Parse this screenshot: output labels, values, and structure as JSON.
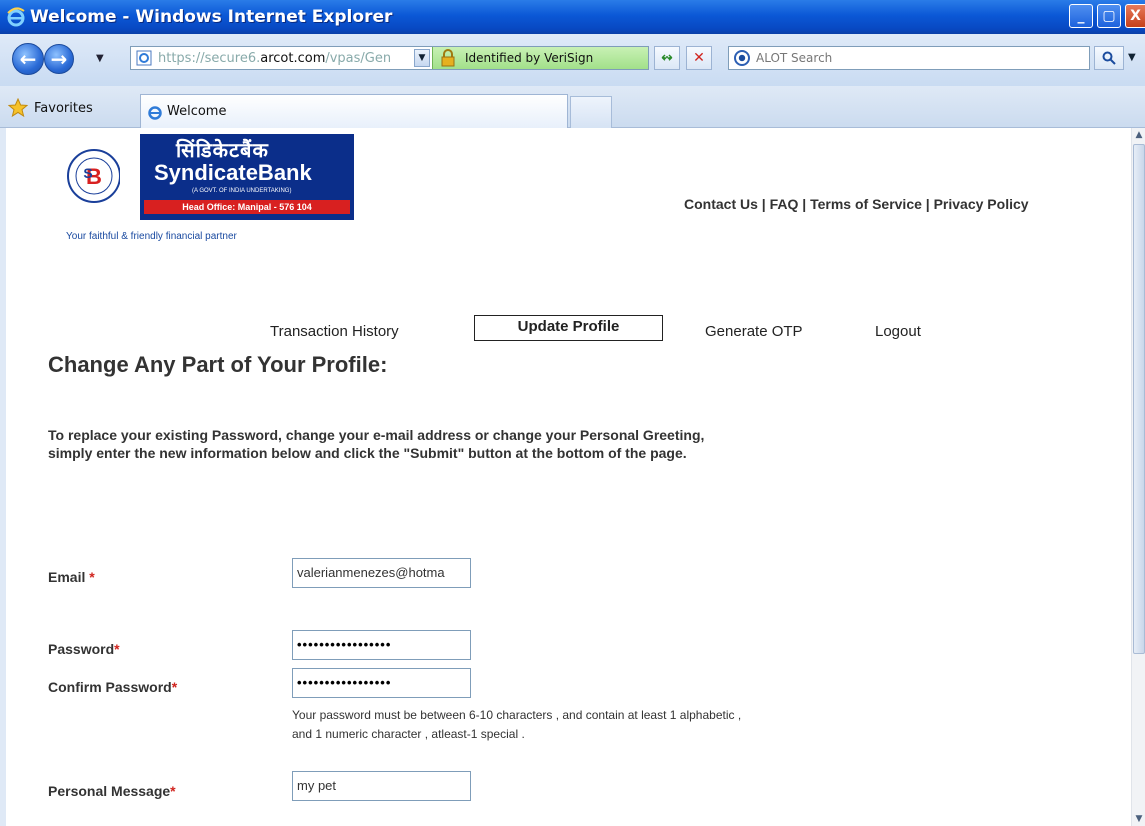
{
  "window": {
    "title": "Welcome - Windows Internet Explorer",
    "controls": {
      "minimize": "_",
      "maximize": "▢",
      "close": "X"
    }
  },
  "navbar": {
    "url_scheme": "https://",
    "url_sub": "secure6.",
    "url_host": "arcot.com",
    "url_path": "/vpas/Gen",
    "security_label": "Identified by VeriSign",
    "search_placeholder": "ALOT Search"
  },
  "favorites": {
    "label": "Favorites",
    "tab_title": "Welcome"
  },
  "page": {
    "logo": {
      "hindi_text": "सिंडिकेटबैंक",
      "brand": "SyndicateBank",
      "govt_note": "(A GOVT. OF INDIA UNDERTAKING)",
      "head_office": "Head Office: Manipal - 576 104",
      "tagline": "Your faithful & friendly financial partner"
    },
    "top_links": {
      "contact": "Contact Us",
      "faq": "FAQ",
      "terms": "Terms of Service",
      "privacy": "Privacy Policy",
      "separator": " | "
    },
    "menu": {
      "history": "Transaction History",
      "update": "Update Profile",
      "otp": "Generate OTP",
      "logout": "Logout"
    },
    "heading": "Change Any Part of Your Profile:",
    "intro": "To replace your existing Password, change your e-mail address or change your Personal Greeting, simply enter the new information below and click the \"Submit\" button at the bottom of the page.",
    "form": {
      "email_label": "Email ",
      "email_value": "valerianmenezes@hotma",
      "password_label": "Password",
      "password_value": "•••••••••••••••••",
      "confirm_label": "Confirm Password",
      "confirm_value": "•••••••••••••••••",
      "password_hint": "Your password must be between 6-10 characters , and contain at least 1 alphabetic , and 1 numeric character , atleast-1 special .",
      "message_label": "Personal Message",
      "message_value": "my pet",
      "required_mark": "*"
    }
  }
}
